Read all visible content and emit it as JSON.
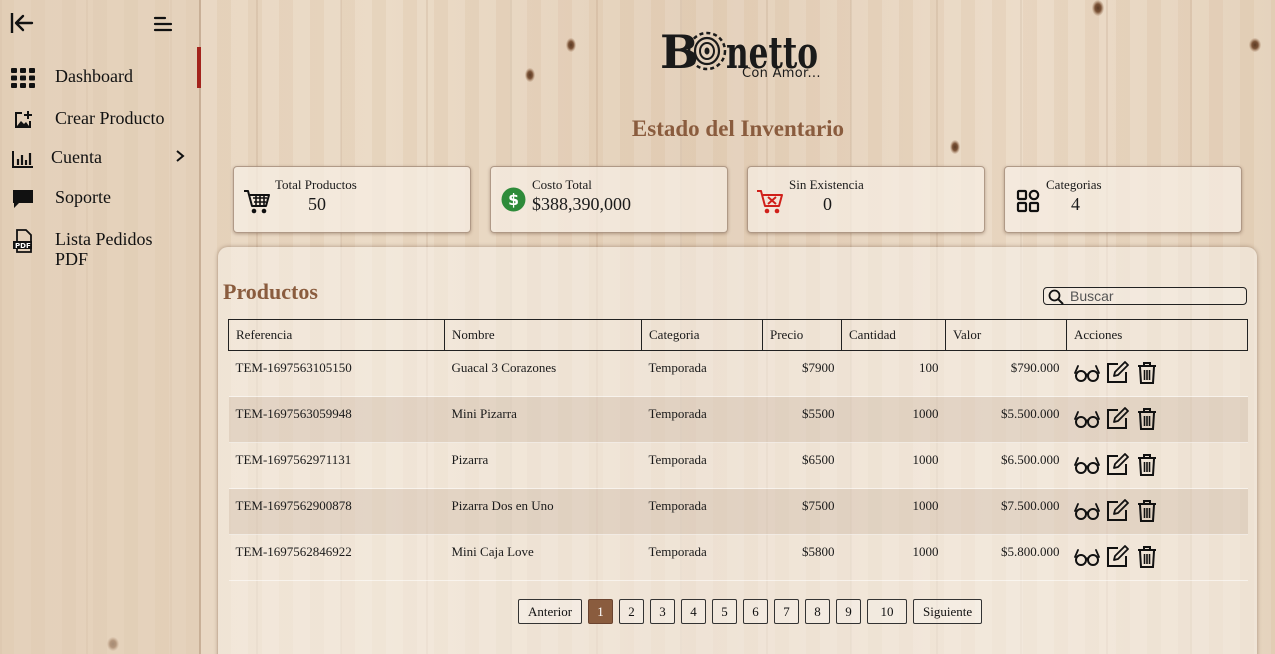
{
  "sidebar": {
    "items": [
      {
        "label": "Dashboard",
        "icon": "grid-icon"
      },
      {
        "label": "Crear Producto",
        "icon": "add-image-icon"
      },
      {
        "label": "Cuenta",
        "icon": "bar-chart-icon"
      },
      {
        "label": "Soporte",
        "icon": "chat-bubble-icon"
      },
      {
        "label": "Lista Pedidos PDF",
        "icon": "pdf-file-icon"
      }
    ]
  },
  "logo": {
    "word": "Bonetto",
    "tagline": "Con Amor..."
  },
  "page_title": "Estado del Inventario",
  "stats": [
    {
      "label": "Total Productos",
      "value": "50"
    },
    {
      "label": "Costo Total",
      "value": "$388,390,000"
    },
    {
      "label": "Sin Existencia",
      "value": "0"
    },
    {
      "label": "Categorias",
      "value": "4"
    }
  ],
  "products": {
    "title": "Productos",
    "search_placeholder": "Buscar",
    "columns": [
      "Referencia",
      "Nombre",
      "Categoria",
      "Precio",
      "Cantidad",
      "Valor",
      "Acciones"
    ],
    "rows": [
      {
        "ref": "TEM-1697563105150",
        "name": "Guacal 3 Corazones",
        "category": "Temporada",
        "price": "$7900",
        "qty": "100",
        "value": "$790.000"
      },
      {
        "ref": "TEM-1697563059948",
        "name": "Mini Pizarra",
        "category": "Temporada",
        "price": "$5500",
        "qty": "1000",
        "value": "$5.500.000"
      },
      {
        "ref": "TEM-1697562971131",
        "name": "Pizarra",
        "category": "Temporada",
        "price": "$6500",
        "qty": "1000",
        "value": "$6.500.000"
      },
      {
        "ref": "TEM-1697562900878",
        "name": "Pizarra Dos en Uno",
        "category": "Temporada",
        "price": "$7500",
        "qty": "1000",
        "value": "$7.500.000"
      },
      {
        "ref": "TEM-1697562846922",
        "name": "Mini Caja Love",
        "category": "Temporada",
        "price": "$5800",
        "qty": "1000",
        "value": "$5.800.000"
      }
    ]
  },
  "pagination": {
    "prev": "Anterior",
    "next": "Siguiente",
    "pages": [
      "1",
      "2",
      "3",
      "4",
      "5",
      "6",
      "7",
      "8",
      "9",
      "10"
    ],
    "current": "1"
  },
  "colors": {
    "accent": "#8a5c3e",
    "active_marker": "#a3231c",
    "dollar_green": "#2e8b3a",
    "empty_cart_red": "#d0201a"
  }
}
